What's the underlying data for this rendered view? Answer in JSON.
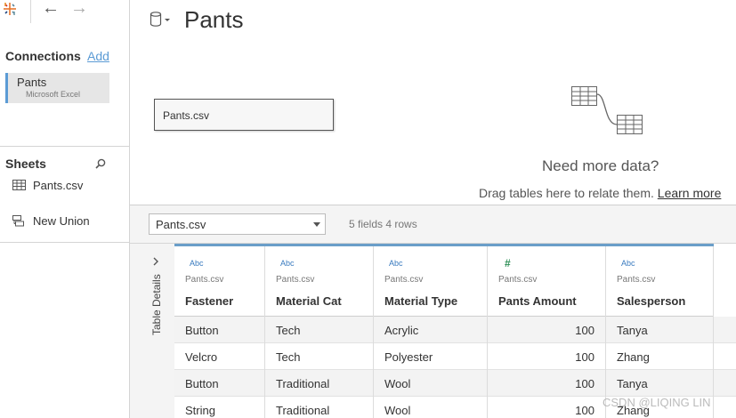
{
  "app": {
    "nav_back": "←",
    "nav_forward": "→"
  },
  "connections": {
    "title": "Connections",
    "add_label": "Add",
    "items": [
      {
        "name": "Pants",
        "type": "Microsoft Excel"
      }
    ]
  },
  "sheets": {
    "title": "Sheets",
    "items": [
      {
        "label": "Pants.csv",
        "icon": "table-icon"
      },
      {
        "label": "New Union",
        "icon": "union-icon"
      }
    ]
  },
  "canvas": {
    "datasource_title": "Pants",
    "table_box": "Pants.csv",
    "need_more": "Need more data?",
    "drag_hint": "Drag tables here to relate them.",
    "learn_more": "Learn more"
  },
  "grid_toolbar": {
    "selected_table": "Pants.csv",
    "summary": "5 fields 4 rows",
    "table_details_label": "Table Details"
  },
  "grid": {
    "columns": [
      {
        "type": "Abc",
        "source": "Pants.csv",
        "name": "Fastener"
      },
      {
        "type": "Abc",
        "source": "Pants.csv",
        "name": "Material Cat"
      },
      {
        "type": "Abc",
        "source": "Pants.csv",
        "name": "Material Type"
      },
      {
        "type": "#",
        "source": "Pants.csv",
        "name": "Pants Amount"
      },
      {
        "type": "Abc",
        "source": "Pants.csv",
        "name": "Salesperson"
      }
    ],
    "rows": [
      [
        "Button",
        "Tech",
        "Acrylic",
        "100",
        "Tanya"
      ],
      [
        "Velcro",
        "Tech",
        "Polyester",
        "100",
        "Zhang"
      ],
      [
        "Button",
        "Traditional",
        "Wool",
        "100",
        "Tanya"
      ],
      [
        "String",
        "Traditional",
        "Wool",
        "100",
        "Zhang"
      ]
    ]
  },
  "watermark": "CSDN @LIQING LIN",
  "colors": {
    "accent": "#5b9bd5",
    "grid_header_line": "#6a9ec9",
    "string_type": "#3a7bbf",
    "number_type": "#2f8f57"
  }
}
